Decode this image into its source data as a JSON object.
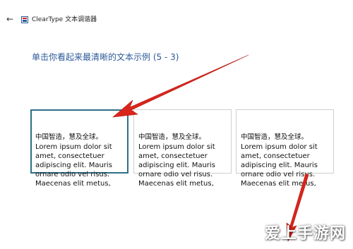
{
  "window": {
    "back_glyph": "←",
    "app_icon": "cleartype-app-icon",
    "title": "ClearType 文本调谐器"
  },
  "instruction": "单击你看起来最清晰的文本示例 (5 - 3)",
  "samples": [
    {
      "line1": "中国智造，慧及全球。",
      "body": "Lorem ipsum dolor sit\namet, consectetuer\nadipiscing elit. Mauris\nornare odio vel risus.\nMaecenas elit metus,",
      "selected": true
    },
    {
      "line1": "中国智造，慧及全球。",
      "body": "Lorem ipsum dolor sit\namet, consectetuer\nadipiscing elit. Mauris\nornare odio vel risus.\nMaecenas elit metus,",
      "selected": false
    },
    {
      "line1": "中国智造，慧及全球。",
      "body": "Lorem ipsum dolor sit\namet, consectetuer\nadipiscing elit. Mauris\nornare odio vel risus.\nMaecenas elit metus,",
      "selected": false
    }
  ],
  "colors": {
    "accent": "#2b5a99",
    "selected_border": "#2f6f87",
    "arrow": "#d9251c"
  },
  "watermark": {
    "text": "爱上手游网"
  }
}
